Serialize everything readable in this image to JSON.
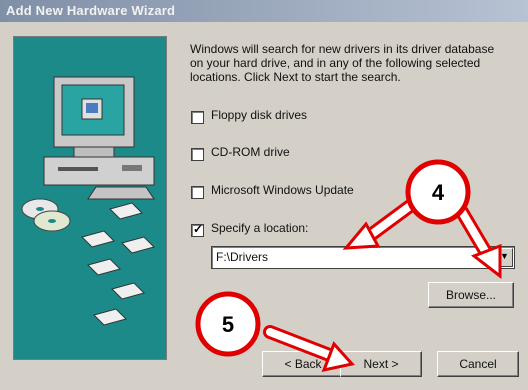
{
  "window": {
    "title": "Add New Hardware Wizard"
  },
  "intro_text": "Windows will search for new drivers in its driver database on your hard drive, and in any of the following selected locations. Click Next to start the search.",
  "options": [
    {
      "label": "Floppy disk drives",
      "checked": false
    },
    {
      "label": "CD-ROM drive",
      "checked": false
    },
    {
      "label": "Microsoft Windows Update",
      "checked": false
    },
    {
      "label": "Specify a location:",
      "checked": true
    }
  ],
  "location": {
    "value": "F:\\Drivers"
  },
  "buttons": {
    "browse": "Browse...",
    "back": "< Back",
    "next": "Next >",
    "cancel": "Cancel"
  },
  "annotations": {
    "badge4": "4",
    "badge5": "5",
    "color": "#e00000"
  },
  "icons": {
    "combo_arrow": "▼",
    "check": "✓"
  }
}
